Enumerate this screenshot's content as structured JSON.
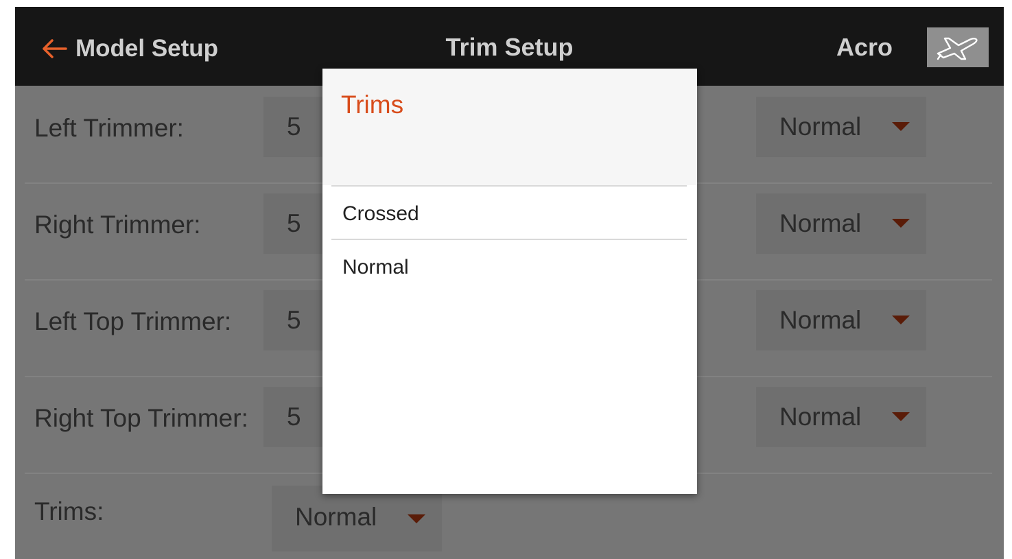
{
  "header": {
    "back_label": "Model Setup",
    "title": "Trim Setup",
    "mode": "Acro",
    "back_icon": "arrow-left-icon",
    "model_icon": "airplane-icon",
    "accent_color": "#e8612b"
  },
  "rows": [
    {
      "label": "Left Trimmer:",
      "step": "5",
      "mode": "Normal"
    },
    {
      "label": "Right Trimmer:",
      "step": "5",
      "mode": "Normal"
    },
    {
      "label": "Left Top Trimmer:",
      "step": "5",
      "mode": "Normal"
    },
    {
      "label": "Right Top Trimmer:",
      "step": "5",
      "mode": "Normal"
    }
  ],
  "trims": {
    "label": "Trims:",
    "value": "Normal"
  },
  "dialog": {
    "title": "Trims",
    "title_color": "#d84c1b",
    "options": [
      "Crossed",
      "Normal"
    ]
  }
}
